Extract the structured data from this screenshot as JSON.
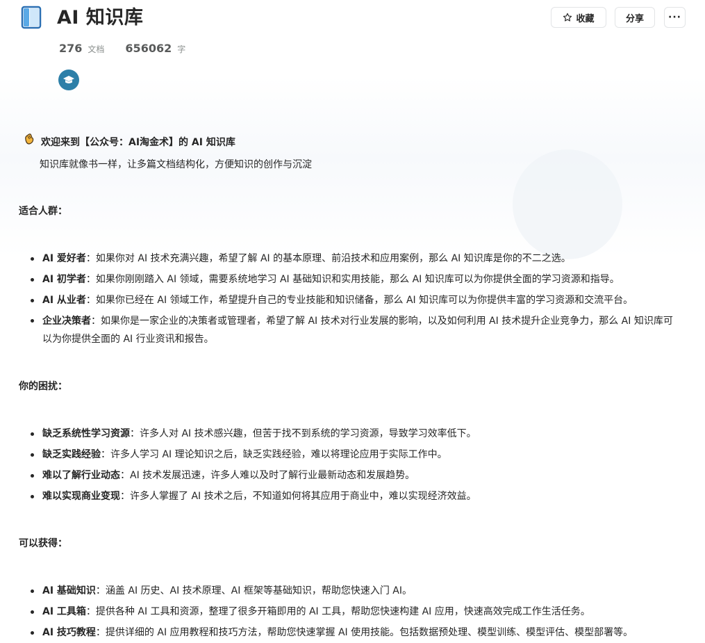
{
  "header": {
    "title": "AI 知识库",
    "docs_count": "276",
    "docs_unit": "文档",
    "words_count": "656062",
    "words_unit": "字",
    "book_icon": "book-icon",
    "badge_icon": "graduation-cap-icon",
    "actions": {
      "favorite_label": "收藏",
      "share_label": "分享",
      "more_label": "···"
    }
  },
  "welcome": {
    "text": "欢迎来到【公众号：AI淘金术】的 AI 知识库",
    "intro": "知识库就像书一样，让多篇文档结构化，方便知识的创作与沉淀"
  },
  "sections": [
    {
      "title": "适合人群：",
      "items": [
        {
          "term": "AI 爱好者",
          "desc": "：如果你对 AI 技术充满兴趣，希望了解 AI 的基本原理、前沿技术和应用案例，那么 AI 知识库是你的不二之选。"
        },
        {
          "term": "AI 初学者",
          "desc": "：如果你刚刚踏入 AI 领域，需要系统地学习 AI 基础知识和实用技能，那么 AI 知识库可以为你提供全面的学习资源和指导。"
        },
        {
          "term": "AI 从业者",
          "desc": "：如果你已经在 AI 领域工作，希望提升自己的专业技能和知识储备，那么 AI 知识库可以为你提供丰富的学习资源和交流平台。"
        },
        {
          "term": "企业决策者",
          "desc": "：如果你是一家企业的决策者或管理者，希望了解 AI 技术对行业发展的影响，以及如何利用 AI 技术提升企业竞争力，那么 AI 知识库可以为你提供全面的 AI 行业资讯和报告。"
        }
      ]
    },
    {
      "title": "你的困扰：",
      "items": [
        {
          "term": "缺乏系统性学习资源",
          "desc": "：许多人对 AI 技术感兴趣，但苦于找不到系统的学习资源，导致学习效率低下。"
        },
        {
          "term": "缺乏实践经验",
          "desc": "：许多人学习 AI 理论知识之后，缺乏实践经验，难以将理论应用于实际工作中。"
        },
        {
          "term": "难以了解行业动态",
          "desc": "：AI 技术发展迅速，许多人难以及时了解行业最新动态和发展趋势。"
        },
        {
          "term": "难以实现商业变现",
          "desc": "：许多人掌握了 AI 技术之后，不知道如何将其应用于商业中，难以实现经济效益。"
        }
      ]
    },
    {
      "title": "可以获得：",
      "items": [
        {
          "term": "AI 基础知识",
          "desc": "：涵盖 AI 历史、AI 技术原理、AI 框架等基础知识，帮助您快速入门 AI。"
        },
        {
          "term": "AI 工具箱",
          "desc": "：提供各种 AI 工具和资源，整理了很多开箱即用的 AI 工具，帮助您快速构建 AI 应用，快速高效完成工作生活任务。"
        },
        {
          "term": "AI 技巧教程",
          "desc": "：提供详细的 AI 应用教程和技巧方法，帮助您快速掌握 AI 使用技能。包括数据预处理、模型训练、模型评估、模型部署等。"
        }
      ]
    }
  ],
  "colors": {
    "text": "#262626",
    "muted": "#8a8f8d",
    "badge": "#2d7fa8",
    "book": "#5aa9e6"
  }
}
